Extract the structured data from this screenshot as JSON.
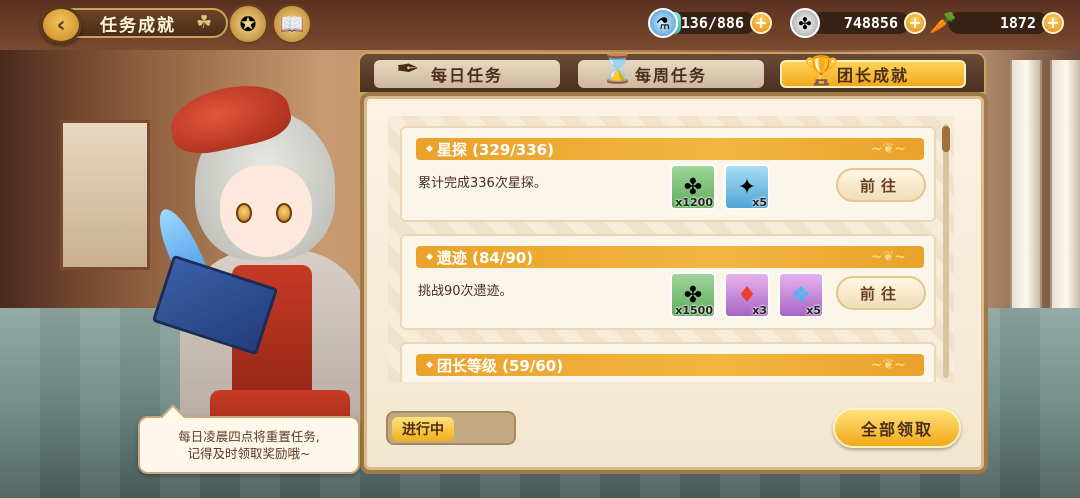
{
  "header": {
    "title": "任务成就",
    "back_icon": "back-arrow-icon"
  },
  "resources": {
    "stamina": {
      "value": "136/886",
      "fill": 0.153,
      "color": "#3cb8b0"
    },
    "silver": {
      "value": "748856"
    },
    "carrot": {
      "value": "1872"
    }
  },
  "tabs": [
    {
      "label": "每日任务",
      "active": false,
      "icon": "quill-book-icon"
    },
    {
      "label": "每周任务",
      "active": false,
      "icon": "hourglass-icon"
    },
    {
      "label": "团长成就",
      "active": true,
      "icon": "trophy-icon"
    }
  ],
  "tasks": [
    {
      "title": "星探 (329/336)",
      "desc": "累计完成336次星探。",
      "rewards": [
        {
          "type": "clover-coin",
          "qty": "x1200",
          "bg": "green"
        },
        {
          "type": "crystal-orb",
          "qty": "x5",
          "bg": "blue"
        }
      ],
      "button": "前往"
    },
    {
      "title": "遗迹 (84/90)",
      "desc": "挑战90次遗迹。",
      "rewards": [
        {
          "type": "clover-coin",
          "qty": "x1500",
          "bg": "green"
        },
        {
          "type": "red-gem",
          "qty": "x3",
          "bg": "purple"
        },
        {
          "type": "crystal-cluster",
          "qty": "x5",
          "bg": "purple"
        }
      ],
      "button": "前往"
    },
    {
      "title": "团长等级 (59/60)",
      "desc": "",
      "rewards": [],
      "button": ""
    }
  ],
  "footer": {
    "status_label": "进行中",
    "claim_all": "全部领取"
  },
  "tip": {
    "line1": "每日凌晨四点将重置任务,",
    "line2": "记得及时领取奖励哦~"
  },
  "colors": {
    "accent": "#f2a81c",
    "card_header": "#e9a22a",
    "text_brown": "#4a2e1a"
  }
}
